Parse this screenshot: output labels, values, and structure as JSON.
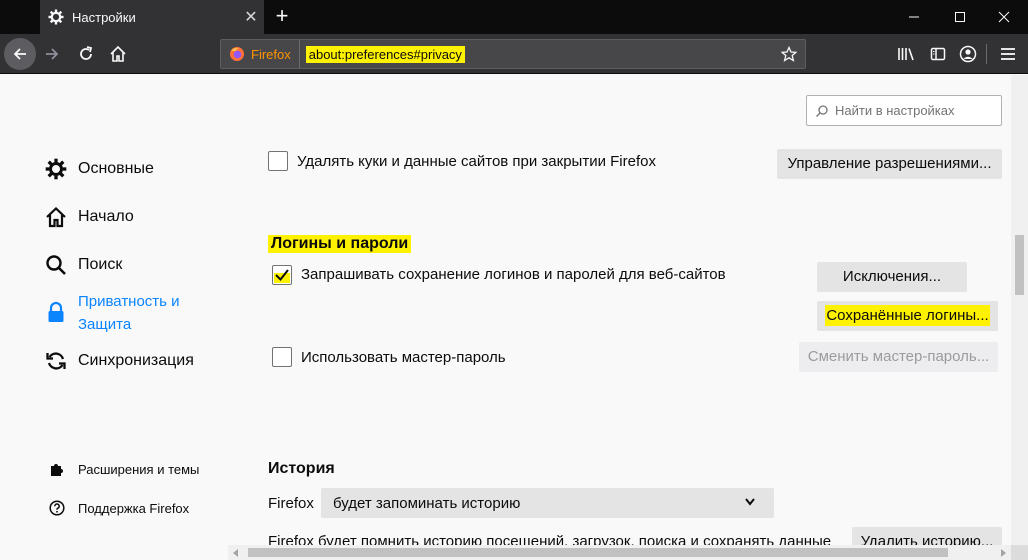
{
  "tab": {
    "title": "Настройки",
    "close": "✕",
    "new_tab": "+"
  },
  "urlbar": {
    "identity_label": "Firefox",
    "url": "about:preferences#privacy"
  },
  "search": {
    "placeholder": "Найти в настройках"
  },
  "sidebar": {
    "categories": [
      {
        "label": "Основные",
        "icon": "gear-icon"
      },
      {
        "label": "Начало",
        "icon": "home-icon"
      },
      {
        "label": "Поиск",
        "icon": "search-icon"
      },
      {
        "label": "Приватность и Защита",
        "line1": "Приватность и",
        "line2": "Защита",
        "icon": "lock-icon",
        "selected": true
      },
      {
        "label": "Синхронизация",
        "icon": "sync-icon"
      }
    ],
    "footer": [
      {
        "label": "Расширения и темы",
        "icon": "puzzle-icon"
      },
      {
        "label": "Поддержка Firefox",
        "icon": "help-icon"
      }
    ]
  },
  "cookies": {
    "delete_on_close_label": "Удалять куки и данные сайтов при закрытии Firefox",
    "delete_on_close_checked": false,
    "manage_permissions_button": "Управление разрешениями..."
  },
  "logins": {
    "heading": "Логины и пароли",
    "ask_save_label": "Запрашивать сохранение логинов и паролей для веб-сайтов",
    "ask_save_checked": true,
    "exceptions_button": "Исключения...",
    "saved_logins_button": "Сохранённые логины...",
    "master_password_label": "Использовать мастер-пароль",
    "master_password_checked": false,
    "change_master_button": "Сменить мастер-пароль..."
  },
  "history": {
    "heading": "История",
    "firefox_label": "Firefox",
    "mode_value": "будет запоминать историю",
    "description": "Firefox будет помнить историю посещений, загрузок, поиска и сохранять данные",
    "clear_button": "Удалить историю..."
  },
  "colors": {
    "accent": "#0a84ff",
    "highlight": "#fff200",
    "chrome_dark": "#323234"
  }
}
